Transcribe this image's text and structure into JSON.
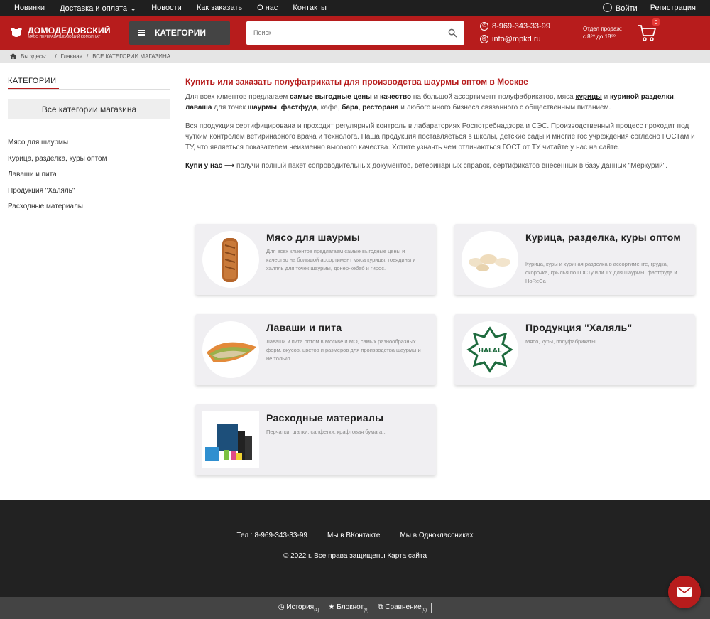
{
  "topnav": {
    "items": [
      "Новинки",
      "Доставка и оплата",
      "Новости",
      "Как заказать",
      "О нас",
      "Контакты"
    ],
    "delivery_arrow": "⌄",
    "login": "Войти",
    "register": "Регистрация"
  },
  "header": {
    "logo_title": "ДОМОДЕДОВСКИЙ",
    "logo_sub": "МЯСО ПЕРЕРАБАТЫВАЮЩИЙ КОМБИНАТ",
    "categories_button": "КАТЕГОРИИ",
    "search_placeholder": "Поиск",
    "phone": "8-969-343-33-99",
    "email": "info@mpkd.ru",
    "hours_line1": "Отдел продаж:",
    "hours_line2": "с 8⁰⁰ до 18⁰⁰",
    "cart_count": "0"
  },
  "breadcrumb": {
    "you_are_here": "Вы здесь:",
    "home": "Главная",
    "current": "ВСЕ КАТЕГОРИИ МАГАЗИНА",
    "sep": "/"
  },
  "sidebar": {
    "title": "КАТЕГОРИИ",
    "all_button": "Все категории магазина",
    "items": [
      "Мясо для шаурмы",
      "Курица, разделка, куры оптом",
      "Лаваши и пита",
      "Продукция \"Халяль\"",
      "Расходные материалы"
    ]
  },
  "main": {
    "heading": "Купить или заказать полуфатрикаты для производства шаурмы оптом в Москве",
    "p1": {
      "a": "Для всех клиентов предлагаем ",
      "b1": "самые выгодные цены",
      "c": " и ",
      "b2": "качество",
      "d": " на большой ассортимент полуфабрикатов, мяса ",
      "u1": "курицы",
      "e": " и ",
      "b3": "куриной разделки",
      "f": ", ",
      "b4": "лаваша",
      "g": " для точек ",
      "b5": "шаурмы",
      "h": ", ",
      "b6": "фастфуда",
      "i": ", кафе, ",
      "b7": "бара",
      "j": ", ",
      "b8": "ресторана",
      "k": " и любого иного бизнеса связанного с общественным питанием."
    },
    "p2": "Вся продукция сертифицирована и проходит регулярный контроль в лабараториях Роспотребнадзора и СЭС. Производственный процесс проходит под чутким контролем ветиринарного врача и технолога. Наша продукция поставляеться в школы, детские сады и многие гос учреждения согласно ГОСТам и ТУ, что являеться показателем неизменно высокого качества. Хотите узначть чем отличаються ГОСТ от ТУ читайте у нас на сайте.",
    "p3_bold": "Купи у нас ⟶",
    "p3": " получи полный пакет сопроводительных документов, ветеринарных справок, сертификатов внесённых в базу данных \"Меркурий\"."
  },
  "cards": [
    {
      "title": "Мясо для шаурмы",
      "desc": "Для всех клиентов предлагаем самые выгодные цены и качество на большой ассортимент мяса курицы, говядины и халяль для точек шаурмы, донер-кебаб и гирос.",
      "icon": "doner-meat-image"
    },
    {
      "title": "Курица, разделка, куры оптом",
      "desc": "Курица, куры и куриная разделка в ассортименте, грудка, окорочка, крылья по ГОСТу или ТУ для шаурмы, фастфуда и HoReCa",
      "icon": "chicken-image"
    },
    {
      "title": "Лаваши и пита",
      "desc": "Лаваши и пита оптом в Москве и МО, самых разнообразных форм, вкусов, цветов и размеров для производства шаурмы и не только.",
      "icon": "lavash-image"
    },
    {
      "title": "Продукция \"Халяль\"",
      "desc": "Мясо, куры, полуфабрикаты",
      "icon": "halal-logo",
      "halal_text": "HALAL"
    },
    {
      "title": "Расходные материалы",
      "desc": "Перчатки, шапки, салфетки, крафтовая бумага...",
      "icon": "supplies-image"
    }
  ],
  "footer": {
    "phone": "Тел : 8-969-343-33-99",
    "vk": "Мы в ВКонтакте",
    "ok": "Мы в Одноклассниках",
    "copyright": "© 2022 г. Все права защищены Карта сайта"
  },
  "bottombar": {
    "history": "История",
    "history_count": "(1)",
    "notebook": "Блокнот",
    "notebook_count": "(0)",
    "compare": "Сравнение",
    "compare_count": "(0)"
  },
  "colors": {
    "brand": "#b71c1c",
    "dark": "#1f1f1f"
  }
}
